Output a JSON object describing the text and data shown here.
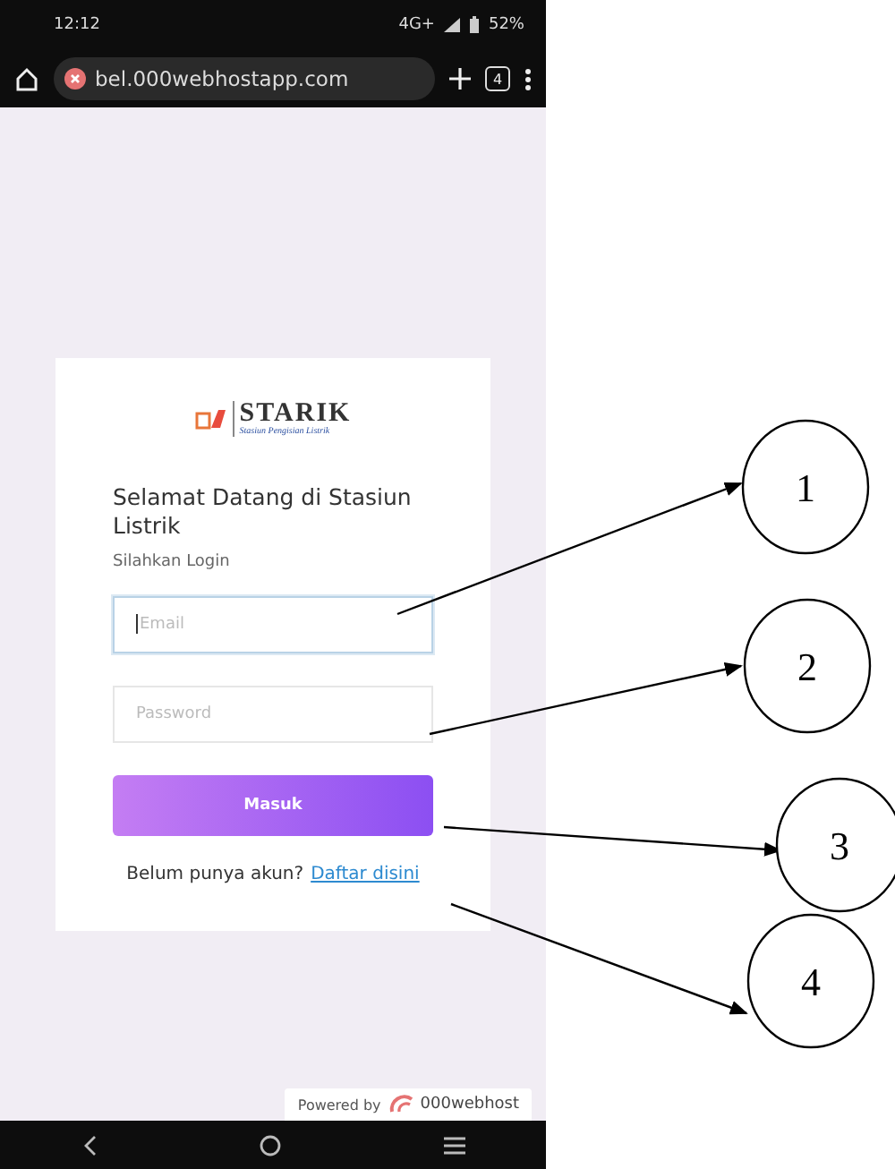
{
  "status_bar": {
    "time": "12:12",
    "network": "4G+",
    "battery": "52%"
  },
  "browser": {
    "url": "bel.000webhostapp.com",
    "tab_count": "4"
  },
  "login_card": {
    "logo": {
      "name": "STARIK",
      "tagline": "Stasiun Pengisian Listrik"
    },
    "title": "Selamat Datang di Stasiun Listrik",
    "subtitle": "Silahkan Login",
    "fields": [
      {
        "placeholder": "Email",
        "focused": true
      },
      {
        "placeholder": "Password",
        "focused": false
      }
    ],
    "button": "Masuk",
    "footer": {
      "text": "Belum punya akun?",
      "link": "Daftar disini"
    }
  },
  "powered_by": {
    "text": "Powered by",
    "brand": "000webhost"
  },
  "callouts": [
    "1",
    "2",
    "3",
    "4"
  ]
}
